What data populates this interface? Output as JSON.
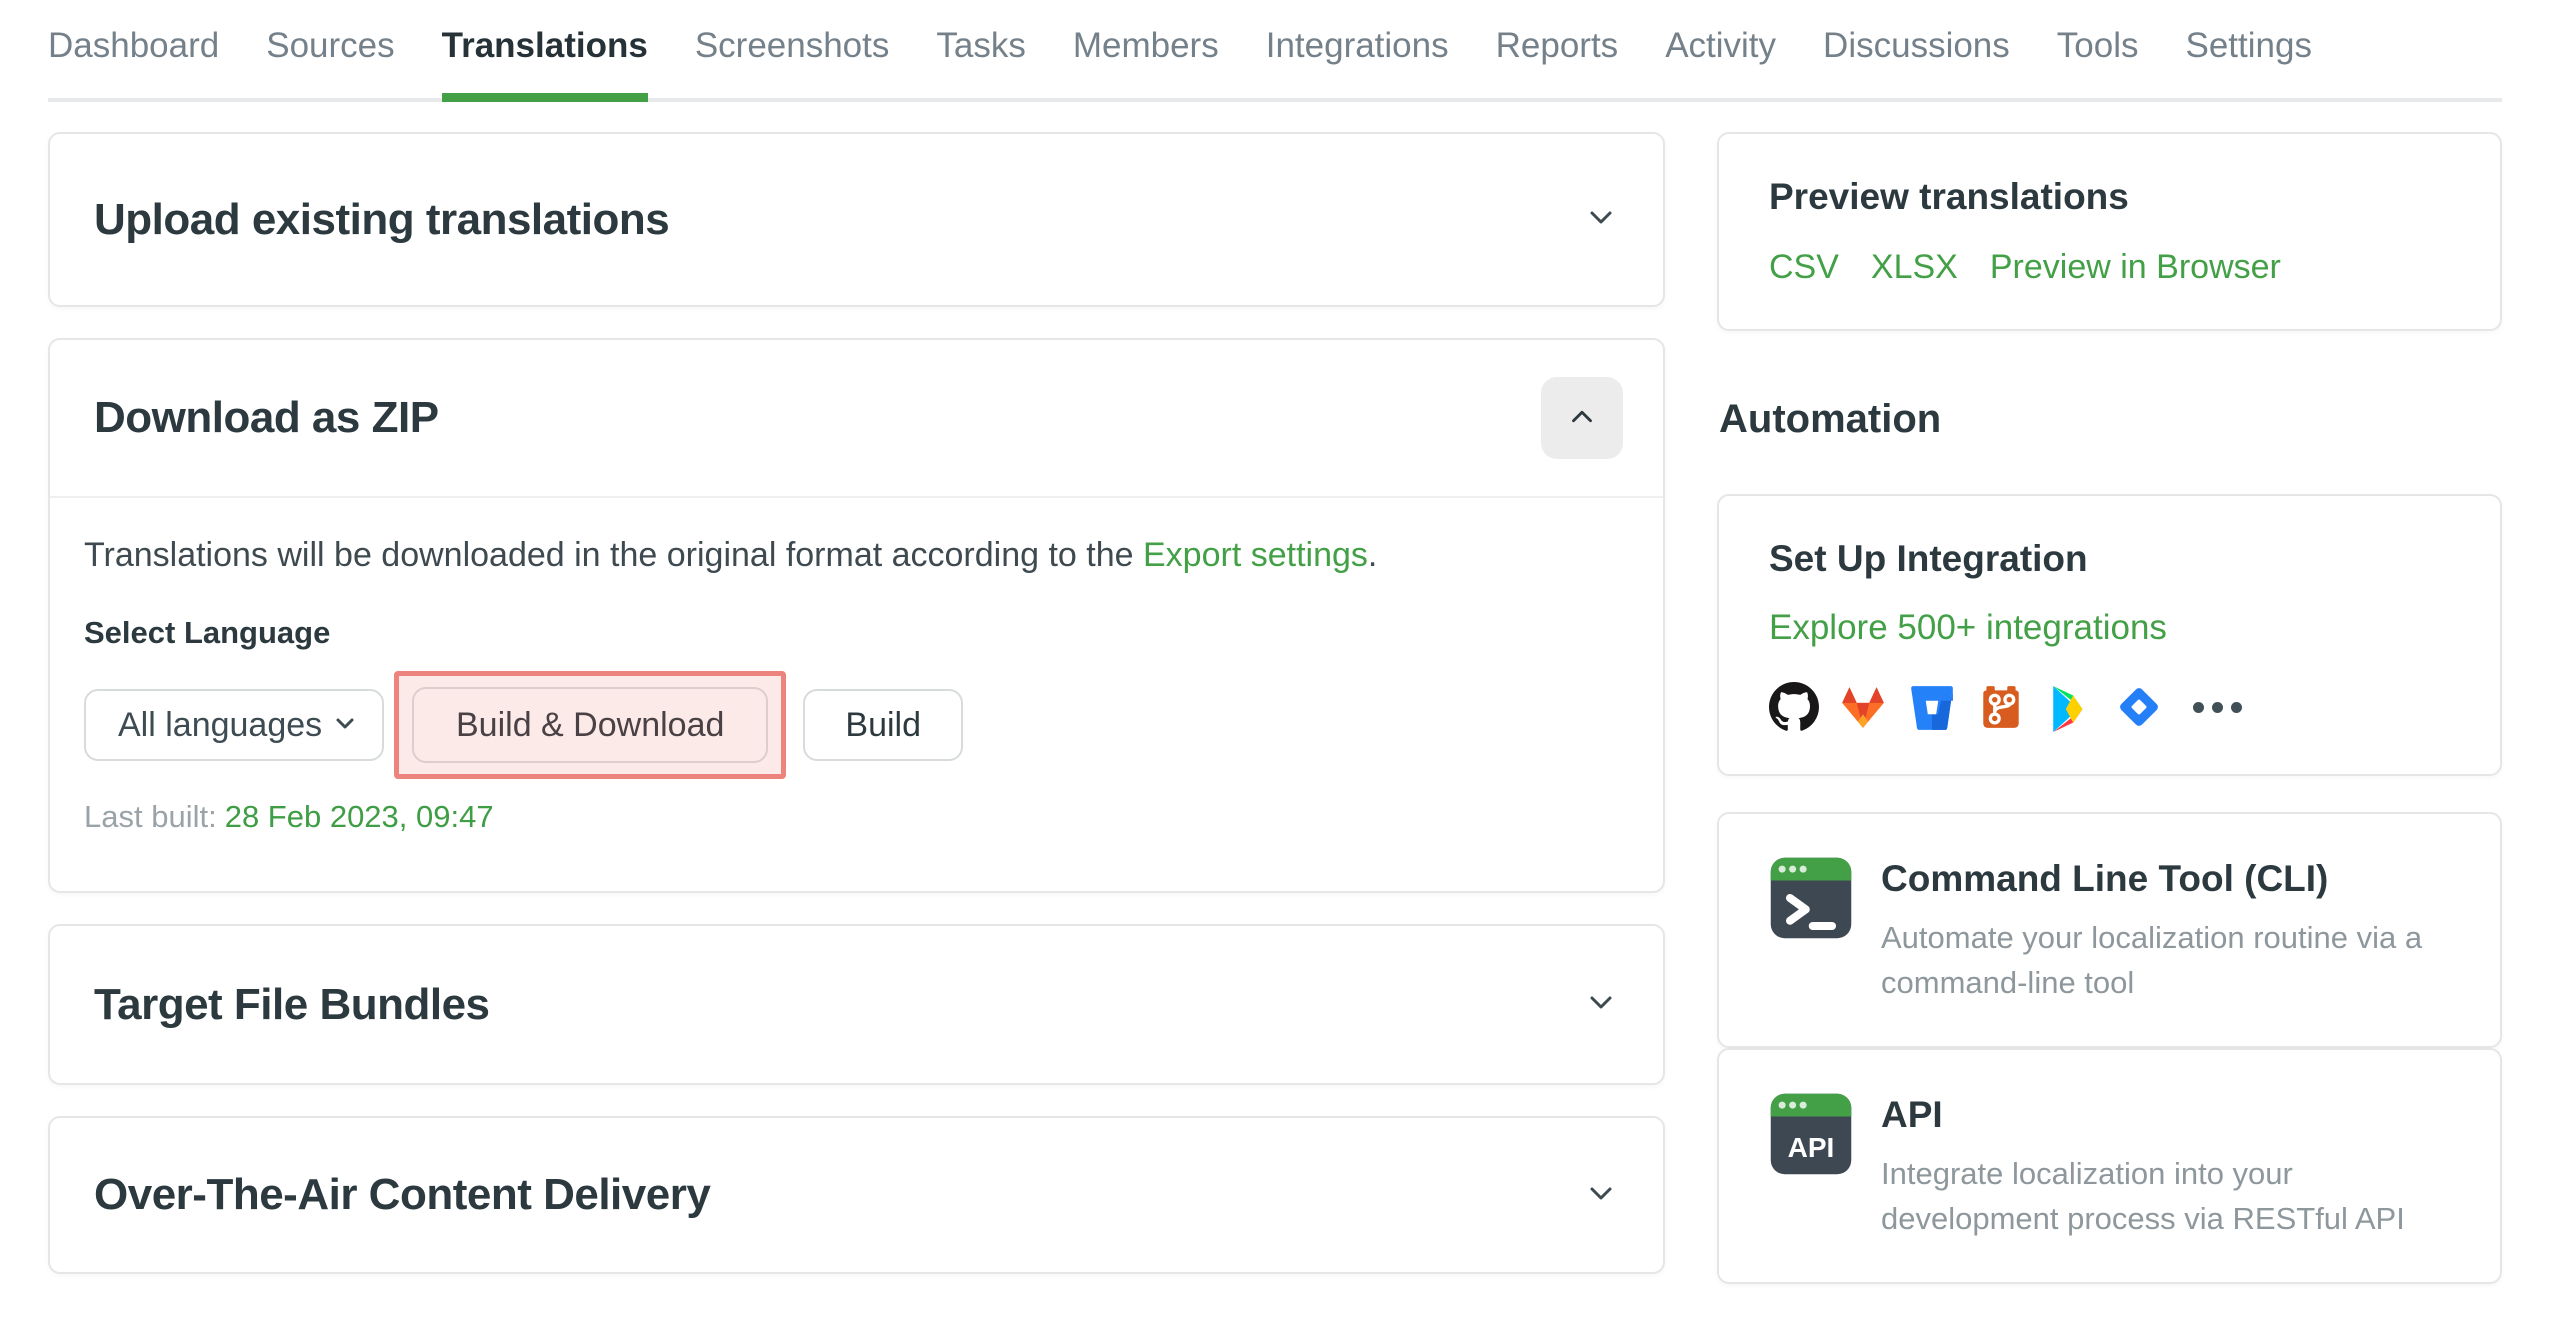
{
  "nav": {
    "items": [
      {
        "label": "Dashboard",
        "active": false
      },
      {
        "label": "Sources",
        "active": false
      },
      {
        "label": "Translations",
        "active": true
      },
      {
        "label": "Screenshots",
        "active": false
      },
      {
        "label": "Tasks",
        "active": false
      },
      {
        "label": "Members",
        "active": false
      },
      {
        "label": "Integrations",
        "active": false
      },
      {
        "label": "Reports",
        "active": false
      },
      {
        "label": "Activity",
        "active": false
      },
      {
        "label": "Discussions",
        "active": false
      },
      {
        "label": "Tools",
        "active": false
      },
      {
        "label": "Settings",
        "active": false
      }
    ]
  },
  "panels": {
    "upload": {
      "title": "Upload existing translations"
    },
    "download": {
      "title": "Download as ZIP",
      "description_prefix": "Translations will be downloaded in the original format according to the ",
      "description_link": "Export settings",
      "description_suffix": ".",
      "select_label": "Select Language",
      "language_value": "All languages",
      "build_download_label": "Build & Download",
      "build_label": "Build",
      "last_built_label": "Last built:",
      "last_built_value": "28 Feb 2023, 09:47"
    },
    "bundles": {
      "title": "Target File Bundles"
    },
    "ota": {
      "title": "Over-The-Air Content Delivery"
    }
  },
  "sidebar": {
    "preview": {
      "title": "Preview translations",
      "links": {
        "csv": "CSV",
        "xlsx": "XLSX",
        "browser": "Preview in Browser"
      }
    },
    "automation_heading": "Automation",
    "integration": {
      "title": "Set Up Integration",
      "link": "Explore 500+ integrations",
      "icons": [
        "github",
        "gitlab",
        "bitbucket",
        "git",
        "google-play",
        "jira",
        "more"
      ]
    },
    "cli": {
      "title": "Command Line Tool (CLI)",
      "description": "Automate your localization routine via a command-line tool"
    },
    "api": {
      "title": "API",
      "description": "Integrate localization into your development process via RESTful API"
    }
  },
  "colors": {
    "accent_green": "#43a047",
    "active_tab_text": "#263238",
    "highlight_annotation_border": "#ec837c",
    "highlight_annotation_fill": "#fceae9",
    "tool_icon_body": "#3d4852"
  }
}
